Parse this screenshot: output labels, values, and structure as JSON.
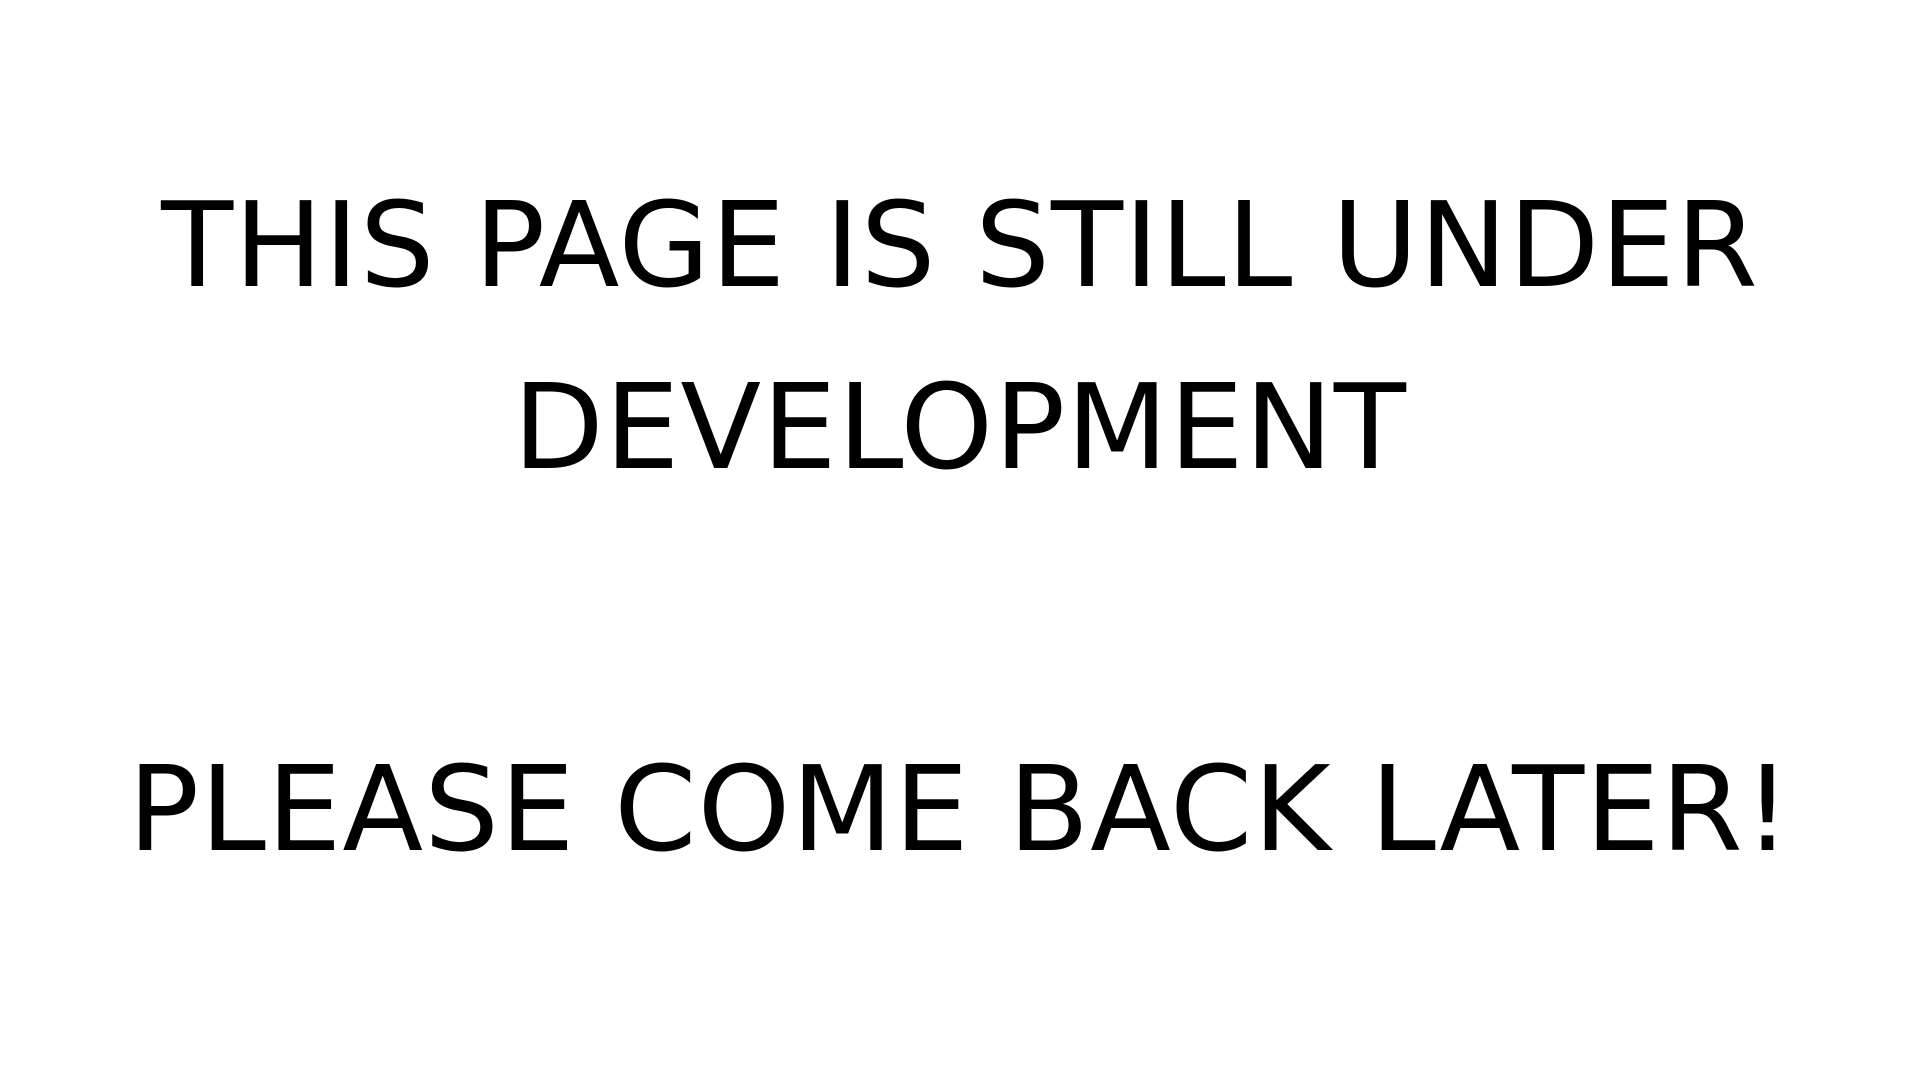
{
  "page": {
    "headline_line1": "THIS PAGE IS STILL UNDER",
    "headline_line2": "DEVELOPMENT",
    "subline": "PLEASE COME BACK LATER!"
  },
  "colors": {
    "background": "#ffffff",
    "text": "#000000"
  }
}
